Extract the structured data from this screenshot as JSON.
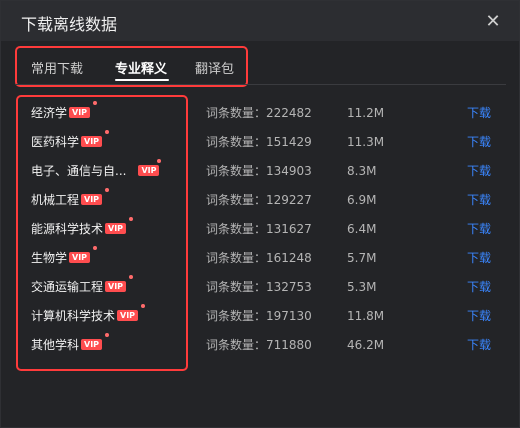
{
  "window": {
    "title": "下载离线数据"
  },
  "tabs": [
    {
      "label": "常用下载"
    },
    {
      "label": "专业释义"
    },
    {
      "label": "翻译包"
    }
  ],
  "rows": [
    {
      "name": "经济学",
      "vip": "VIP",
      "count": "词条数量：222482",
      "size": "11.2M",
      "action": "下载"
    },
    {
      "name": "医药科学",
      "vip": "VIP",
      "count": "词条数量：151429",
      "size": "11.3M",
      "action": "下载"
    },
    {
      "name": "电子、通信与自...",
      "vip": "VIP",
      "count": "词条数量：134903",
      "size": "8.3M",
      "action": "下载"
    },
    {
      "name": "机械工程",
      "vip": "VIP",
      "count": "词条数量：129227",
      "size": "6.9M",
      "action": "下载"
    },
    {
      "name": "能源科学技术",
      "vip": "VIP",
      "count": "词条数量：131627",
      "size": "6.4M",
      "action": "下载"
    },
    {
      "name": "生物学",
      "vip": "VIP",
      "count": "词条数量：161248",
      "size": "5.7M",
      "action": "下载"
    },
    {
      "name": "交通运输工程",
      "vip": "VIP",
      "count": "词条数量：132753",
      "size": "5.3M",
      "action": "下载"
    },
    {
      "name": "计算机科学技术",
      "vip": "VIP",
      "count": "词条数量：197130",
      "size": "11.8M",
      "action": "下载"
    },
    {
      "name": "其他学科",
      "vip": "VIP",
      "count": "词条数量：711880",
      "size": "46.2M",
      "action": "下载"
    }
  ],
  "icons": {
    "close": "close-icon"
  },
  "colors": {
    "highlight_border": "#ff3b3b",
    "link": "#3a86ff",
    "vip_badge": "#ff4d4f"
  }
}
